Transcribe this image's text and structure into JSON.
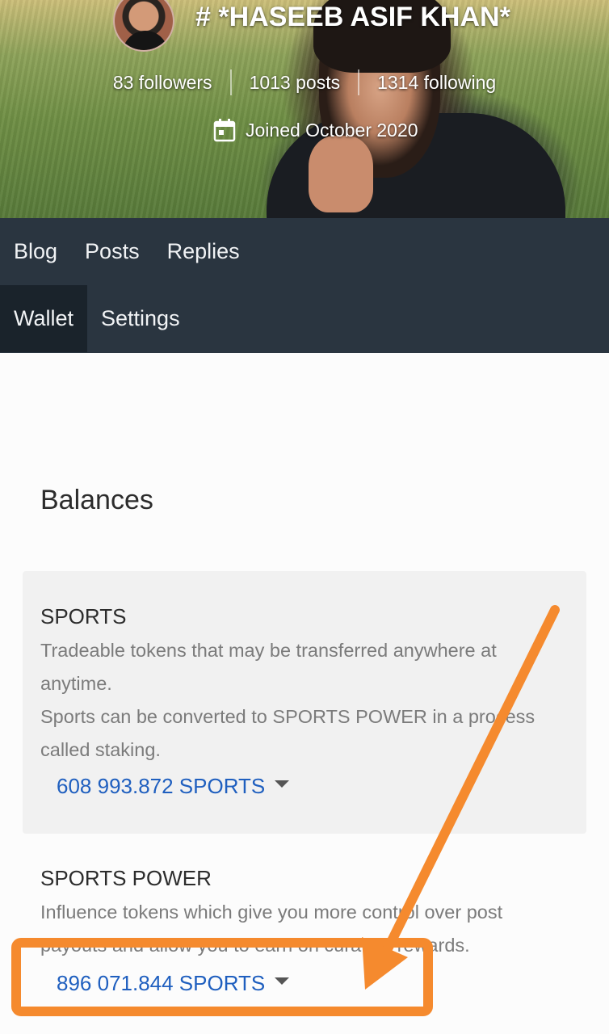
{
  "profile": {
    "name": "# *HASEEB ASIF KHAN*",
    "stats": [
      {
        "label": "83 followers"
      },
      {
        "label": "1013 posts"
      },
      {
        "label": "1314 following"
      }
    ],
    "joined": "Joined October 2020",
    "calendar_icon": "calendar-icon"
  },
  "nav": {
    "row1": [
      "Blog",
      "Posts",
      "Replies"
    ],
    "row2": [
      "Wallet",
      "Settings"
    ],
    "active": "Wallet"
  },
  "balances": {
    "title": "Balances",
    "sports": {
      "title": "SPORTS",
      "desc_line1": "Tradeable tokens that may be transferred anywhere at anytime.",
      "desc_line2": "Sports can be converted to SPORTS POWER in a process called staking.",
      "amount": "608 993.872 SPORTS"
    },
    "sports_power": {
      "title": "SPORTS POWER",
      "desc": "Influence tokens which give you more control over post payouts and allow you to earn on curation rewards.",
      "amount": "896 071.844 SPORTS"
    }
  },
  "colors": {
    "nav_bg": "#2a3540",
    "nav_active_bg": "#1a232b",
    "link": "#1f5fbf",
    "annotation": "#f58a2e"
  }
}
